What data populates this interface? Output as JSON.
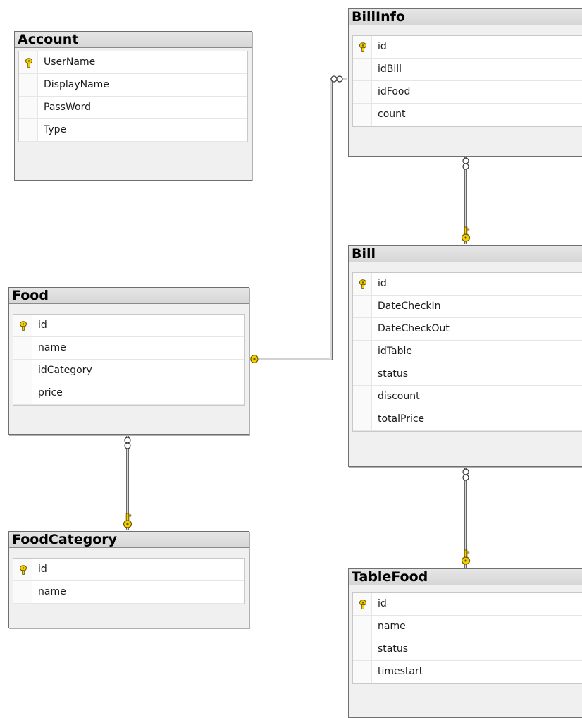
{
  "diagram": {
    "tables": [
      {
        "id": "account",
        "title": "Account",
        "columns": [
          {
            "name": "UserName",
            "pk": true
          },
          {
            "name": "DisplayName",
            "pk": false
          },
          {
            "name": "PassWord",
            "pk": false
          },
          {
            "name": "Type",
            "pk": false
          }
        ]
      },
      {
        "id": "billinfo",
        "title": "BillInfo",
        "columns": [
          {
            "name": "id",
            "pk": true
          },
          {
            "name": "idBill",
            "pk": false
          },
          {
            "name": "idFood",
            "pk": false
          },
          {
            "name": "count",
            "pk": false
          }
        ]
      },
      {
        "id": "bill",
        "title": "Bill",
        "columns": [
          {
            "name": "id",
            "pk": true
          },
          {
            "name": "DateCheckIn",
            "pk": false
          },
          {
            "name": "DateCheckOut",
            "pk": false
          },
          {
            "name": "idTable",
            "pk": false
          },
          {
            "name": "status",
            "pk": false
          },
          {
            "name": "discount",
            "pk": false
          },
          {
            "name": "totalPrice",
            "pk": false
          }
        ]
      },
      {
        "id": "food",
        "title": "Food",
        "columns": [
          {
            "name": "id",
            "pk": true
          },
          {
            "name": "name",
            "pk": false
          },
          {
            "name": "idCategory",
            "pk": false
          },
          {
            "name": "price",
            "pk": false
          }
        ]
      },
      {
        "id": "foodcategory",
        "title": "FoodCategory",
        "columns": [
          {
            "name": "id",
            "pk": true
          },
          {
            "name": "name",
            "pk": false
          }
        ]
      },
      {
        "id": "tablefood",
        "title": "TableFood",
        "columns": [
          {
            "name": "id",
            "pk": true
          },
          {
            "name": "name",
            "pk": false
          },
          {
            "name": "status",
            "pk": false
          },
          {
            "name": "timestart",
            "pk": false
          }
        ]
      }
    ],
    "relationships": [
      {
        "from": "billinfo",
        "to": "food",
        "many_end": "billinfo",
        "one_end": "food"
      },
      {
        "from": "billinfo",
        "to": "bill",
        "many_end": "billinfo",
        "one_end": "bill"
      },
      {
        "from": "food",
        "to": "foodcategory",
        "many_end": "food",
        "one_end": "foodcategory"
      },
      {
        "from": "bill",
        "to": "tablefood",
        "many_end": "bill",
        "one_end": "tablefood"
      }
    ],
    "colors": {
      "key_yellow": "#f5d000",
      "key_outline": "#6b5500",
      "line": "#6a6a6a"
    }
  }
}
